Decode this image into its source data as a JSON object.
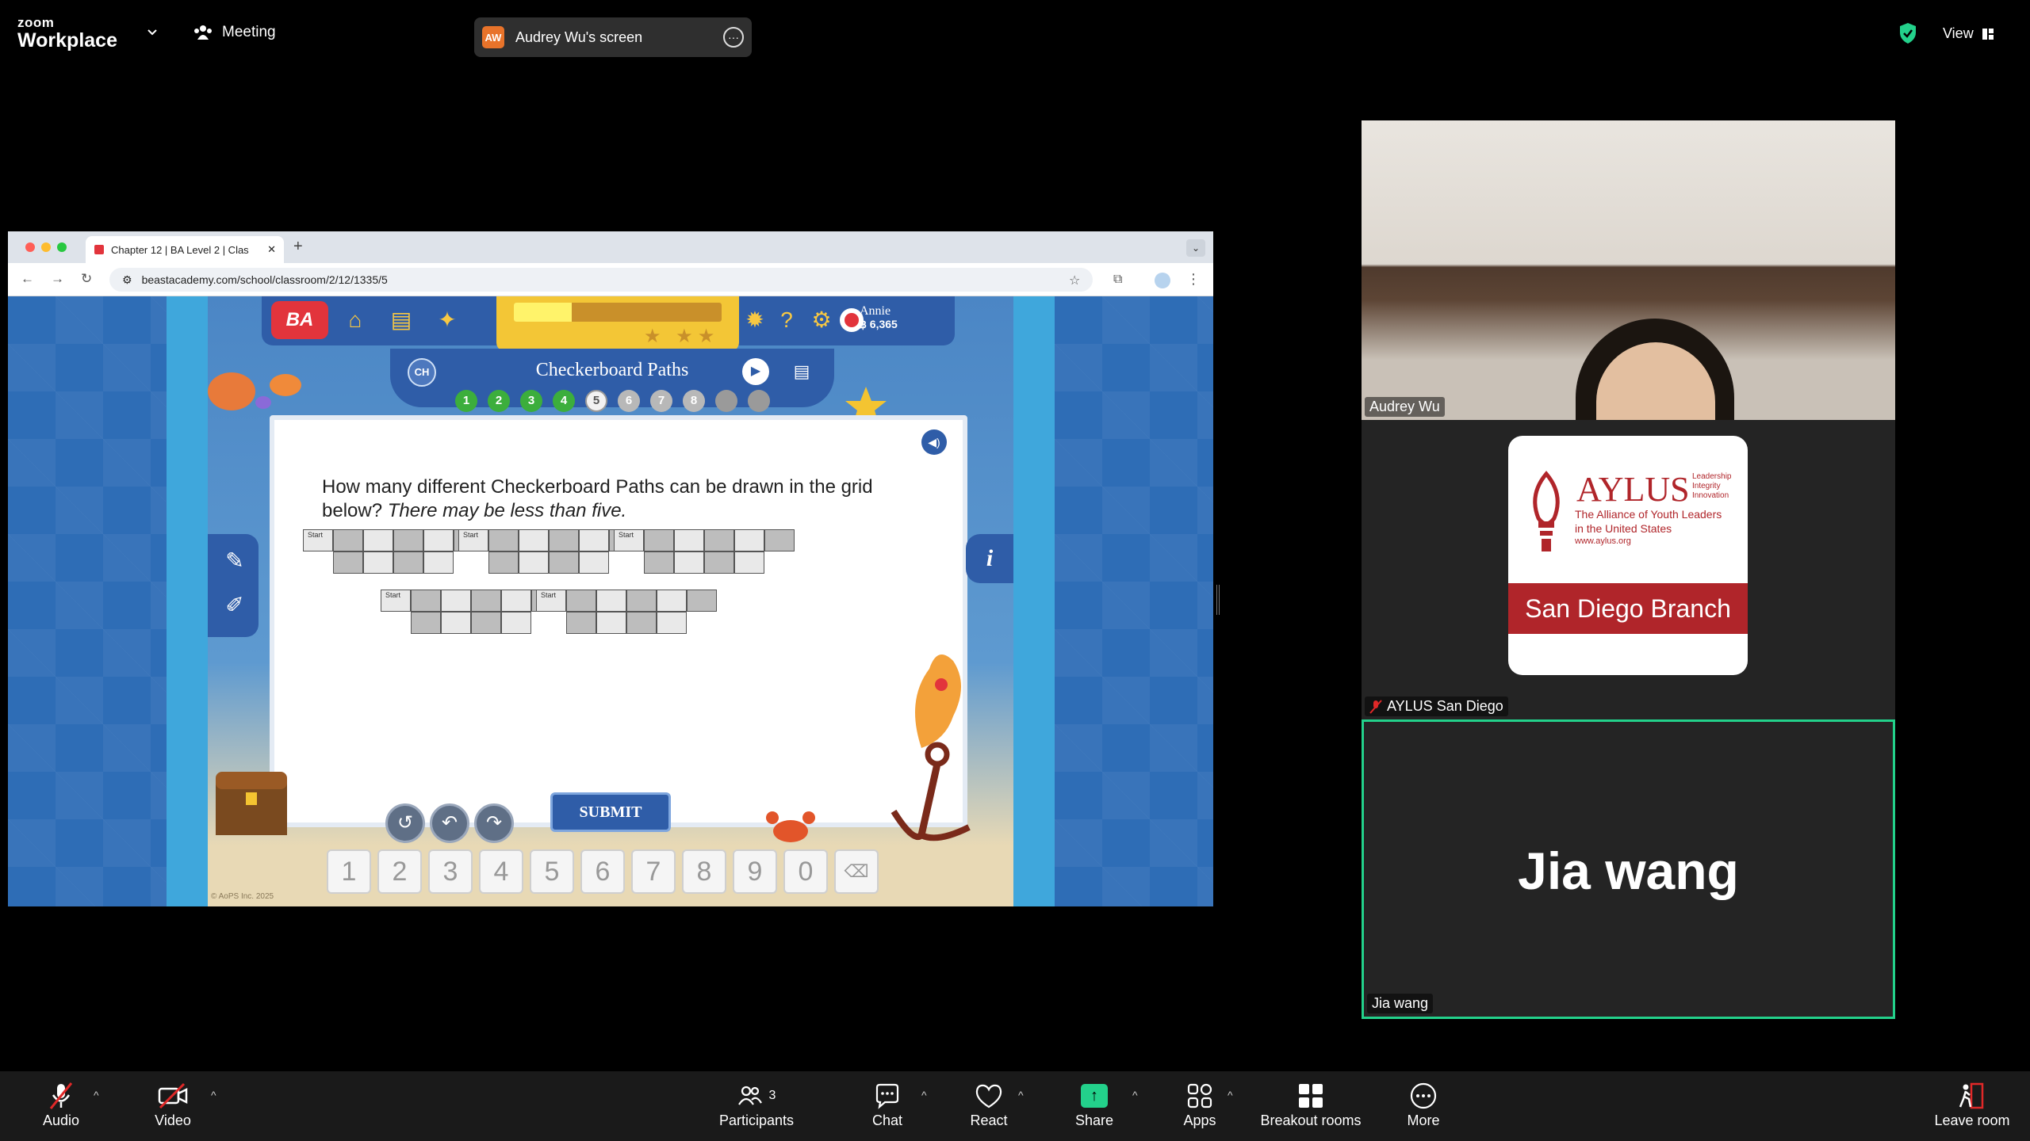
{
  "app": {
    "brand_top": "zoom",
    "brand_bottom": "Workplace",
    "meeting_label": "Meeting",
    "screen_share_label": "Audrey Wu's screen",
    "screen_share_initials": "AW",
    "view_label": "View"
  },
  "browser": {
    "tab_title": "Chapter 12 | BA Level 2 | Clas",
    "url": "beastacademy.com/school/classroom/2/12/1335/5"
  },
  "game": {
    "logo": "BA",
    "user_name": "Annie",
    "user_points": "฿ 6,365",
    "chapter_badge": "CH",
    "chapter_title": "Checkerboard Paths",
    "progress_fraction": 0.28,
    "levels": [
      "1",
      "2",
      "3",
      "4",
      "5",
      "6",
      "7",
      "8",
      "",
      ""
    ],
    "question_main": "How many different Checkerboard Paths can be drawn in the grid below? ",
    "question_italic": "There may be less than five.",
    "grid_label": "Start",
    "submit_label": "SUBMIT",
    "keys": [
      "1",
      "2",
      "3",
      "4",
      "5",
      "6",
      "7",
      "8",
      "9",
      "0"
    ],
    "backspace_icon": "backspace-icon",
    "copyright": "© AoPS Inc. 2025"
  },
  "participants_panel": {
    "tile1_name": "Audrey Wu",
    "tile2_name": "AYLUS San Diego",
    "tile3_name": "Jia wang",
    "tile3_big": "Jia wang",
    "logo": {
      "title": "AYLUS",
      "tagline": [
        "Leadership",
        "Integrity",
        "Innovation"
      ],
      "sub1": "The Alliance of Youth Leaders",
      "sub2": "in the United States",
      "sub_url": "www.aylus.org",
      "branch": "San Diego Branch"
    }
  },
  "toolbar": {
    "audio": "Audio",
    "video": "Video",
    "participants": "Participants",
    "participants_count": "3",
    "chat": "Chat",
    "react": "React",
    "share": "Share",
    "apps": "Apps",
    "breakout": "Breakout rooms",
    "more": "More",
    "leave": "Leave room"
  },
  "colors": {
    "share_green": "#23d18b",
    "mute_red": "#e02828",
    "aylus_red": "#b0252a",
    "game_blue": "#2f5da8"
  }
}
